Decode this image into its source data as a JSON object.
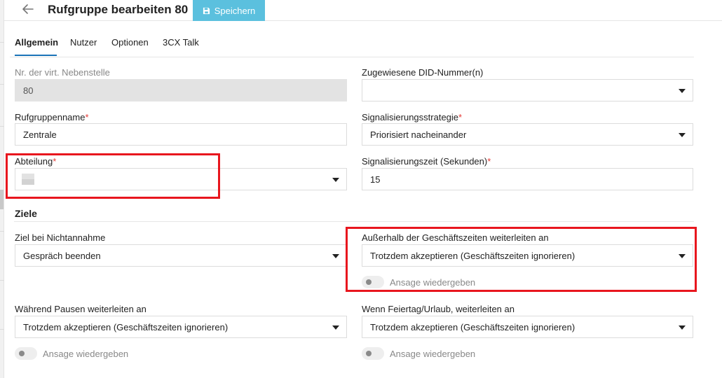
{
  "header": {
    "title": "Rufgruppe bearbeiten 80",
    "save_label": "Speichern"
  },
  "tabs": [
    {
      "label": "Allgemein",
      "active": true
    },
    {
      "label": "Nutzer"
    },
    {
      "label": "Optionen"
    },
    {
      "label": "3CX Talk"
    }
  ],
  "form": {
    "extension": {
      "label": "Nr. der virt. Nebenstelle",
      "value": "80"
    },
    "did": {
      "label": "Zugewiesene DID-Nummer(n)",
      "value": ""
    },
    "group_name": {
      "label": "Rufgruppenname",
      "required_mark": "*",
      "value": "Zentrale"
    },
    "ring_strategy": {
      "label": "Signalisierungsstrategie",
      "required_mark": "*",
      "value": "Priorisiert nacheinander"
    },
    "department": {
      "label": "Abteilung",
      "required_mark": "*",
      "value": ""
    },
    "ring_time": {
      "label": "Signalisierungszeit (Sekunden)",
      "required_mark": "*",
      "value": "15"
    }
  },
  "destinations": {
    "section_title": "Ziele",
    "no_answer": {
      "label": "Ziel bei Nichtannahme",
      "value": "Gespräch beenden"
    },
    "outside_hours": {
      "label": "Außerhalb der Geschäftszeiten weiterleiten an",
      "value": "Trotzdem akzeptieren (Geschäftszeiten ignorieren)",
      "toggle_label": "Ansage wiedergeben",
      "toggle_on": false
    },
    "during_breaks": {
      "label": "Während Pausen weiterleiten an",
      "value": "Trotzdem akzeptieren (Geschäftszeiten ignorieren)",
      "toggle_label": "Ansage wiedergeben",
      "toggle_on": false
    },
    "holiday": {
      "label": "Wenn Feiertag/Urlaub, weiterleiten an",
      "value": "Trotzdem akzeptieren (Geschäftszeiten ignorieren)",
      "toggle_label": "Ansage wiedergeben",
      "toggle_on": false
    }
  },
  "colors": {
    "accent": "#5bc0de",
    "highlight": "#e8161e",
    "required": "#e53935"
  }
}
